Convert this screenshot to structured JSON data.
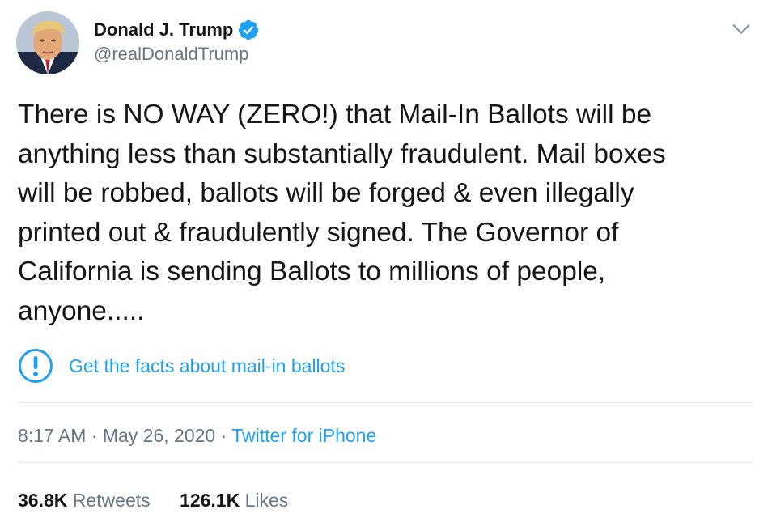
{
  "author": {
    "display_name": "Donald J. Trump",
    "handle": "@realDonaldTrump",
    "verified": true,
    "avatar_icon": "profile-photo"
  },
  "tweet": {
    "text": "There is NO WAY (ZERO!) that Mail-In Ballots will be\nanything less than substantially fraudulent. Mail boxes\nwill be robbed, ballots will be forged & even illegally\nprinted out & fraudulently signed. The Governor of\nCalifornia is sending Ballots to millions of people,\nanyone....."
  },
  "notice": {
    "icon": "exclamation-circle-icon",
    "label": "Get the facts about mail-in ballots"
  },
  "meta": {
    "time": "8:17 AM",
    "separator": "·",
    "date": "May 26, 2020",
    "source": "Twitter for iPhone"
  },
  "stats": {
    "retweets_count": "36.8K",
    "retweets_label": "Retweets",
    "likes_count": "126.1K",
    "likes_label": "Likes"
  },
  "colors": {
    "link": "#1da1f2",
    "secondary_text": "#657786",
    "primary_text": "#14171a",
    "divider": "#e1e8ed"
  }
}
